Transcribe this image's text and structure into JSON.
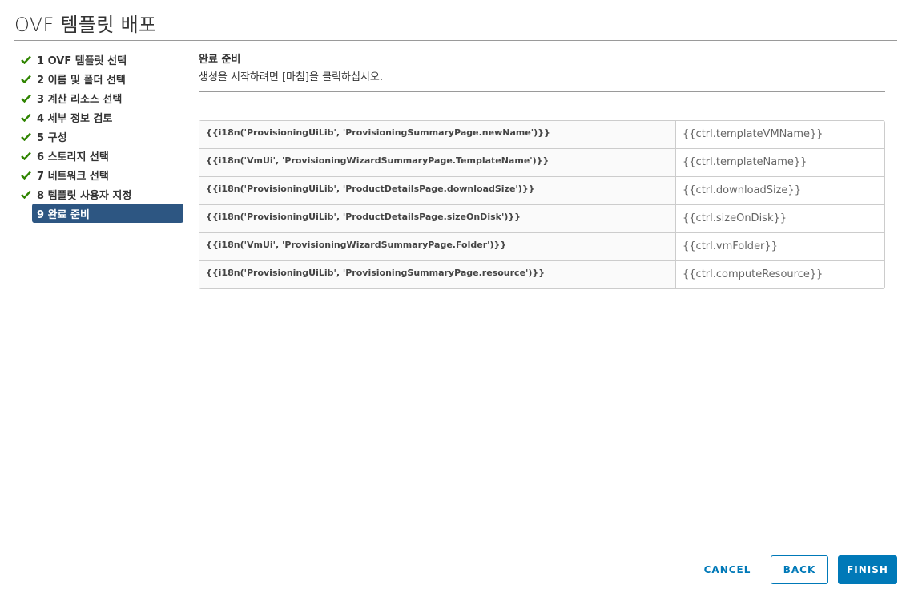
{
  "dialog": {
    "title": "OVF 템플릿 배포"
  },
  "steps": [
    {
      "label": "1 OVF 템플릿 선택",
      "state": "complete"
    },
    {
      "label": "2 이름 및 폴더 선택",
      "state": "complete"
    },
    {
      "label": "3 계산 리소스 선택",
      "state": "complete"
    },
    {
      "label": "4 세부 정보 검토",
      "state": "complete"
    },
    {
      "label": "5 구성",
      "state": "complete"
    },
    {
      "label": "6 스토리지 선택",
      "state": "complete"
    },
    {
      "label": "7 네트워크 선택",
      "state": "complete"
    },
    {
      "label": "8 템플릿 사용자 지정",
      "state": "complete"
    },
    {
      "label": "9 완료 준비",
      "state": "active"
    }
  ],
  "content": {
    "heading": "완료 준비",
    "description": "생성을 시작하려면 [마침]을 클릭하십시오."
  },
  "summary": {
    "rows": [
      {
        "key": "{{i18n('ProvisioningUiLib', 'ProvisioningSummaryPage.newName')}}",
        "value": "{{ctrl.templateVMName}}"
      },
      {
        "key": "{{i18n('VmUi', 'ProvisioningWizardSummaryPage.TemplateName')}}",
        "value": "{{ctrl.templateName}}"
      },
      {
        "key": "{{i18n('ProvisioningUiLib', 'ProductDetailsPage.downloadSize')}}",
        "value": "{{ctrl.downloadSize}}"
      },
      {
        "key": "{{i18n('ProvisioningUiLib', 'ProductDetailsPage.sizeOnDisk')}}",
        "value": "{{ctrl.sizeOnDisk}}"
      },
      {
        "key": "{{i18n('VmUi', 'ProvisioningWizardSummaryPage.Folder')}}",
        "value": "{{ctrl.vmFolder}}"
      },
      {
        "key": "{{i18n('ProvisioningUiLib', 'ProvisioningSummaryPage.resource')}}",
        "value": "{{ctrl.computeResource}}"
      }
    ]
  },
  "footer": {
    "cancel_label": "CANCEL",
    "back_label": "BACK",
    "finish_label": "FINISH"
  },
  "icons": {
    "step_complete": "check-icon"
  },
  "colors": {
    "check": "#2f8400",
    "active_step_bg": "#2d5682",
    "primary": "#0079b8"
  }
}
